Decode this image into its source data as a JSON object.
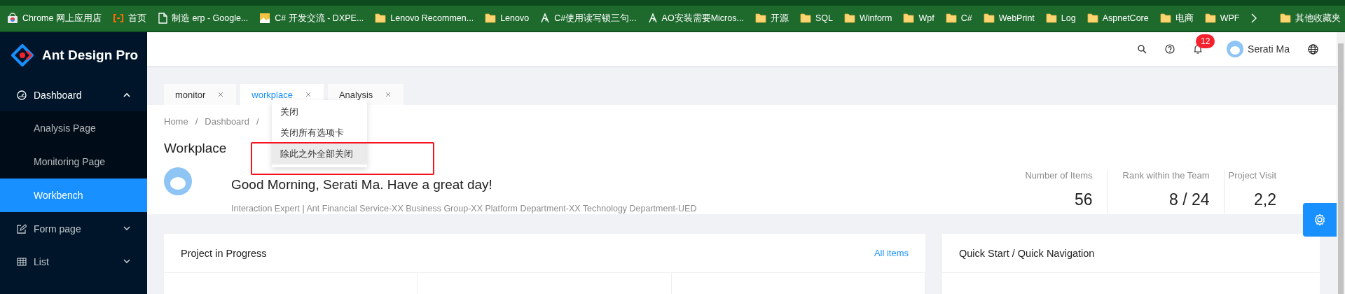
{
  "bookmarks": [
    {
      "label": "Chrome 网上应用店"
    },
    {
      "label": "首页"
    },
    {
      "label": "制造 erp - Google..."
    },
    {
      "label": "C# 开发交流 - DXPE..."
    },
    {
      "label": "Lenovo Recommen..."
    },
    {
      "label": "Lenovo"
    },
    {
      "label": "C#使用读写锁三句..."
    },
    {
      "label": "AO安装需要Micros..."
    },
    {
      "label": "开源"
    },
    {
      "label": "SQL"
    },
    {
      "label": "Winform"
    },
    {
      "label": "Wpf"
    },
    {
      "label": "C#"
    },
    {
      "label": "WebPrint"
    },
    {
      "label": "Log"
    },
    {
      "label": "AspnetCore"
    },
    {
      "label": "电商"
    },
    {
      "label": "WPF"
    }
  ],
  "other_bookmarks": {
    "label": "其他收藏夹"
  },
  "sidebar": {
    "logo_text": "Ant Design Pro",
    "items": [
      {
        "label": "Dashboard",
        "expanded": true,
        "children": [
          {
            "label": "Analysis Page",
            "selected": false
          },
          {
            "label": "Monitoring Page",
            "selected": false
          },
          {
            "label": "Workbench",
            "selected": true
          }
        ]
      },
      {
        "label": "Form page",
        "expanded": false
      },
      {
        "label": "List",
        "expanded": false
      }
    ]
  },
  "header": {
    "notification_count": "12",
    "user_name": "Serati Ma"
  },
  "tabs": [
    {
      "label": "monitor",
      "selected": false
    },
    {
      "label": "workplace",
      "selected": true
    },
    {
      "label": "Analysis",
      "selected": false
    }
  ],
  "context_menu": {
    "items": [
      {
        "label": "关闭",
        "highlighted": false
      },
      {
        "label": "关闭所有选项卡",
        "highlighted": false
      },
      {
        "label": "除此之外全部关闭",
        "highlighted": true
      }
    ]
  },
  "breadcrumb": {
    "items": [
      "Home",
      "Dashboard"
    ],
    "separator": "/"
  },
  "page_title": "Workplace",
  "greeting": "Good Morning, Serati Ma. Have a great day!",
  "subtitle": "Interaction Expert | Ant Financial Service-XX Business Group-XX Platform Department-XX Technology Department-UED",
  "stats": [
    {
      "label": "Number of Items",
      "value": "56"
    },
    {
      "label": "Rank within the Team",
      "value": "8 / 24"
    },
    {
      "label": "Project Visit",
      "value": "2,2"
    }
  ],
  "cards": [
    {
      "title": "Project in Progress",
      "link": "All items"
    },
    {
      "title": "Quick Start / Quick Navigation"
    }
  ]
}
